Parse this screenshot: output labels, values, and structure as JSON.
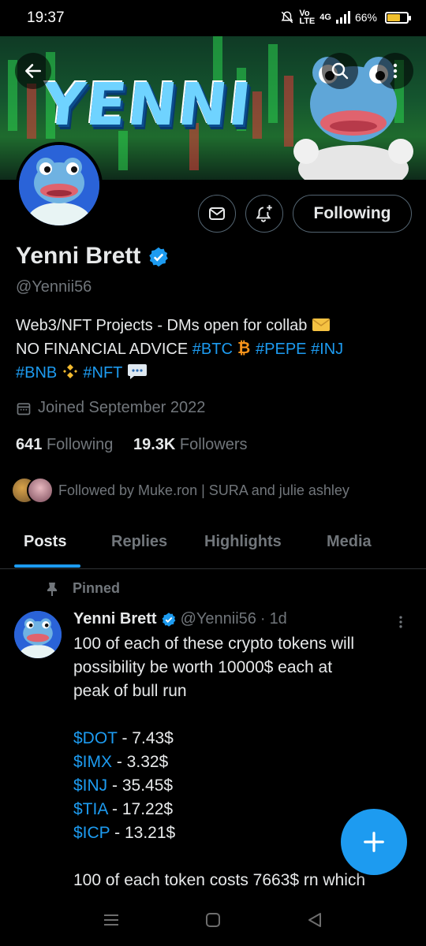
{
  "status_bar": {
    "time": "19:37",
    "network_top": "Vo",
    "network_bottom": "LTE",
    "signal_label": "4G",
    "battery": "66%",
    "battery_level": 0.66
  },
  "banner": {
    "title": "YENNI",
    "back_icon": "back-arrow-icon",
    "search_icon": "search-icon",
    "more_icon": "more-vertical-icon"
  },
  "profile": {
    "name": "Yenni Brett",
    "handle": "@Yennii56",
    "bio_line1_text": "Web3/NFT Projects -  DMs open for collab",
    "bio_line2_text": "NO FINANCIAL ADVICE",
    "bio_tags": {
      "btc": "#BTC",
      "pepe": "#PEPE",
      "inj": "#INJ",
      "bnb": "#BNB",
      "nft": "#NFT"
    },
    "joined": "Joined September 2022",
    "following_count": "641",
    "following_label": "Following",
    "followers_count": "19.3K",
    "followers_label": "Followers",
    "followed_by": "Followed by Muke.ron | SURA and julie ashley"
  },
  "actions": {
    "message_icon": "mail-icon",
    "notify_icon": "bell-plus-icon",
    "following_button": "Following"
  },
  "tabs": [
    {
      "label": "Posts",
      "active": true
    },
    {
      "label": "Replies",
      "active": false
    },
    {
      "label": "Highlights",
      "active": false
    },
    {
      "label": "Media",
      "active": false
    }
  ],
  "post": {
    "pinned_label": "Pinned",
    "author_name": "Yenni Brett",
    "author_handle": "@Yennii56",
    "separator": "·",
    "time": "1d",
    "text_lines": [
      "100 of each of these crypto tokens will",
      "possibility be worth 10000$ each at",
      "peak of bull run"
    ],
    "tokens": [
      {
        "tag": "$DOT",
        "price": " - 7.43$"
      },
      {
        "tag": "$IMX",
        "price": " - 3.32$"
      },
      {
        "tag": "$INJ",
        "price": " - 35.45$"
      },
      {
        "tag": "$TIA",
        "price": " - 17.22$"
      },
      {
        "tag": "$ICP",
        "price": " - 13.21$"
      }
    ],
    "footer_line": "100 of each token costs 7663$ rn which"
  },
  "fab": {
    "icon": "plus-icon"
  },
  "nav": {
    "menu_icon": "menu-icon",
    "home_icon": "home-square-icon",
    "back_icon": "back-triangle-icon"
  },
  "colors": {
    "accent": "#1d9bf0",
    "secondary_text": "#71767b",
    "primary_text": "#e7e9ea",
    "background": "#000000"
  }
}
